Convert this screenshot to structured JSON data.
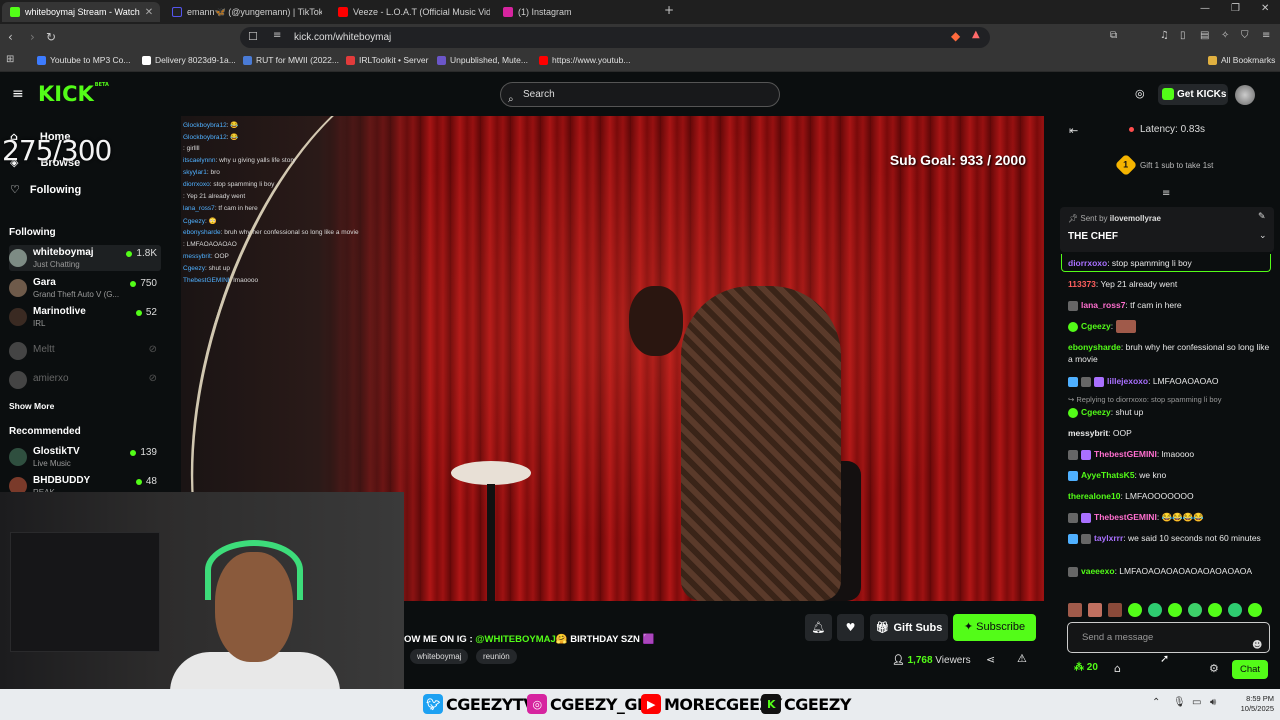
{
  "browser": {
    "tabs": [
      {
        "label": "whiteboymaj Stream - Watch",
        "color": "#53fc18",
        "active": true
      },
      {
        "label": "emann🦋 (@yungemann) | TikTok",
        "color": "#111111",
        "active": false
      },
      {
        "label": "Veeze - L.O.A.T (Official Music Video)",
        "color": "#ff0000",
        "active": false
      },
      {
        "label": "(1) Instagram",
        "color": "#d6249f",
        "active": false
      }
    ],
    "url": "kick.com/whiteboymaj",
    "bookmarks": [
      {
        "label": "Youtube to MP3 Co...",
        "color": "#3d7cff"
      },
      {
        "label": "Delivery 8023d9-1a...",
        "color": "#ffffff"
      },
      {
        "label": "RUT for MWII (2022...",
        "color": "#4a7bd6"
      },
      {
        "label": "IRLToolkit • Server",
        "color": "#e23b3b"
      },
      {
        "label": "Unpublished, Mute...",
        "color": "#6b56c9"
      },
      {
        "label": "https://www.youtub...",
        "color": "#ff0000"
      }
    ],
    "all_bookmarks": "All Bookmarks"
  },
  "kick": {
    "logo": "KICK",
    "logo_sup": "BETA",
    "search_placeholder": "Search",
    "get_kicks": "Get KICKs",
    "accent": "#53fc18"
  },
  "sidebar": {
    "nav": [
      {
        "label": "Home",
        "icon": "home-icon"
      },
      {
        "label": "Browse",
        "icon": "compass-icon"
      },
      {
        "label": "Following",
        "icon": "heart-icon"
      }
    ],
    "following_title": "Following",
    "following": [
      {
        "name": "whiteboymaj",
        "category": "Just Chatting",
        "viewers": "1.8K",
        "live": true,
        "color": "#7d8b84"
      },
      {
        "name": "Gara",
        "category": "Grand Theft Auto V (G...",
        "viewers": "750",
        "live": true,
        "color": "#6e5a4a"
      },
      {
        "name": "Marinotlive",
        "category": "IRL",
        "viewers": "52",
        "live": true,
        "color": "#3a2a22"
      },
      {
        "name": "Meltt",
        "category": "",
        "viewers": "",
        "live": false,
        "color": "#555555"
      },
      {
        "name": "amierxo",
        "category": "",
        "viewers": "",
        "live": false,
        "color": "#555555"
      }
    ],
    "show_more": "Show More",
    "recommended_title": "Recommended",
    "recommended": [
      {
        "name": "GlostikTV",
        "category": "Live Music",
        "viewers": "139",
        "color": "#2f4f3f"
      },
      {
        "name": "BHDBUDDY",
        "category": "REAK",
        "viewers": "48",
        "color": "#7a3a2a"
      }
    ]
  },
  "video": {
    "sub_goal": "Sub Goal:  933 / 2000",
    "overlay_chat": [
      {
        "user": "Glockboybra12",
        "text": ": 😂"
      },
      {
        "user": "Glockboybra12",
        "text": ": 😂"
      },
      {
        "user": "",
        "text": ": girllll"
      },
      {
        "user": "itscaelynnn",
        "text": ": why u giving yalls life story"
      },
      {
        "user": "skyylar1",
        "text": ": bro"
      },
      {
        "user": "diorrxoxo",
        "text": ": stop spamming li boy"
      },
      {
        "user": "",
        "text": ": Yep 21 already went"
      },
      {
        "user": "lana_ross7",
        "text": ": tf cam in here"
      },
      {
        "user": "Cgeezy",
        "text": ": 😳"
      },
      {
        "user": "ebonysharde",
        "text": ": bruh why her confessional so long like a movie"
      },
      {
        "user": "",
        "text": ": LMFAOAOAOAO"
      },
      {
        "user": "messybrit",
        "text": ": OOP"
      },
      {
        "user": "Cgeezy",
        "text": ": shut up"
      },
      {
        "user": "ThebestGEMINI",
        "text": ": lmaoooo"
      }
    ],
    "webcam_counter": "275/300"
  },
  "stream": {
    "title_prefix": "OW ME ON IG : ",
    "title_handle": "@WHITEBOYMAJ",
    "title_suffix": "🤗 BIRTHDAY SZN 🟪",
    "tags": [
      "whiteboymaj",
      "reunión"
    ],
    "gift_subs": "Gift Subs",
    "subscribe": "Subscribe",
    "viewers_count": "1,768",
    "viewers_label": "Viewers"
  },
  "chat": {
    "latency": "Latency: 0.83s",
    "gift_prompt": "Gift 1 sub to take 1st",
    "gift_rank": "1",
    "pinned_sender_label": "Sent by",
    "pinned_sender": "ilovemollyrae",
    "pinned_message": "THE CHEF",
    "messages": [
      {
        "user": "diorrxoxo",
        "text": ": stop spamming li boy",
        "color": "#a970ff",
        "badge": ""
      },
      {
        "user": "113373",
        "text": ": Yep 21 already went",
        "color": "#ff5f5f",
        "badge": ""
      },
      {
        "user": "lana_ross7",
        "text": ": tf cam in here",
        "color": "#ff6fcf",
        "badge": "#666666"
      },
      {
        "user": "Cgeezy",
        "text": ":",
        "color": "#53fc18",
        "badge": "#53fc18"
      },
      {
        "user": "ebonysharde",
        "text": ": bruh why her confessional so long like a movie",
        "color": "#53fc18",
        "badge": ""
      },
      {
        "user": "lillejexoxo",
        "text": ": LMFAOAOAOAO",
        "color": "#a970ff",
        "badge": "#4fb0ff"
      },
      {
        "user": "Cgeezy",
        "text": ": shut up",
        "color": "#53fc18",
        "badge": "#53fc18"
      },
      {
        "user": "messybrit",
        "text": ": OOP",
        "color": "#e8e8e8",
        "badge": ""
      },
      {
        "user": "ThebestGEMINI",
        "text": ": lmaoooo",
        "color": "#ff6fcf",
        "badge": "#666666"
      },
      {
        "user": "AyyeThatsK5",
        "text": ": we kno",
        "color": "#53fc18",
        "badge": "#4fb0ff"
      },
      {
        "user": "therealone10",
        "text": ": LMFAOOOOOOO",
        "color": "#53fc18",
        "badge": ""
      },
      {
        "user": "ThebestGEMINI",
        "text": ": 😂😂😂😂",
        "color": "#ff6fcf",
        "badge": "#666666"
      },
      {
        "user": "taylxrrr",
        "text": ": we said 10 seconds not 60 minutes",
        "color": "#a970ff",
        "badge": "#4fb0ff"
      },
      {
        "user": "vaeeexo",
        "text": ": LMFAOAOAOAOAOAOAOAOAOA",
        "color": "#53fc18",
        "badge": "#666666"
      }
    ],
    "reply_note": "Replying to diorrxoxo: stop spamming li boy",
    "send_placeholder": "Send a message",
    "points": "20",
    "chat_button": "Chat"
  },
  "taskbar": {
    "socials": [
      {
        "label": "CGEEZYTV",
        "icon": "twitter-icon",
        "color": "#1da1f2"
      },
      {
        "label": "CGEEZY_GBC",
        "icon": "instagram-icon",
        "color": "#d6249f"
      },
      {
        "label": "MORECGEEZY",
        "icon": "youtube-icon",
        "color": "#ff0000"
      },
      {
        "label": "CGEEZY",
        "icon": "kick-icon",
        "color": "#111111"
      }
    ],
    "time": "8:59 PM",
    "date": "10/5/2025"
  }
}
